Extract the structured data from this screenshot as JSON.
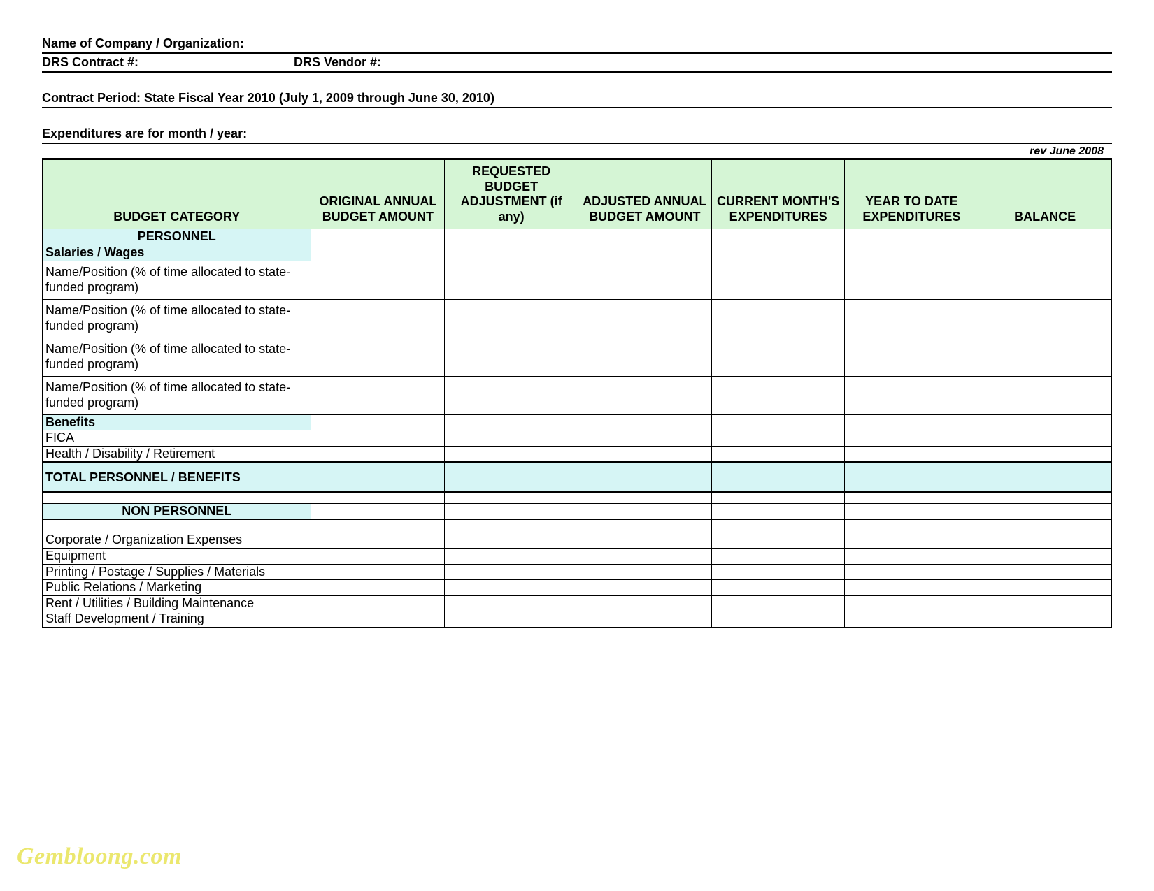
{
  "header": {
    "company_label": "Name of Company / Organization:",
    "contract_label": "DRS Contract #:",
    "vendor_label": "DRS Vendor #:",
    "period_label": "Contract Period: State Fiscal Year 2010 (July 1, 2009 through June 30, 2010)",
    "month_label": "Expenditures are for month / year:",
    "revision": "rev June 2008"
  },
  "columns": [
    "BUDGET CATEGORY",
    "ORIGINAL ANNUAL BUDGET AMOUNT",
    "REQUESTED BUDGET ADJUSTMENT (if any)",
    "ADJUSTED ANNUAL BUDGET AMOUNT",
    "CURRENT MONTH'S EXPENDITURES",
    "YEAR TO DATE EXPENDITURES",
    "BALANCE"
  ],
  "sections": {
    "personnel_title": "PERSONNEL",
    "salaries_title": "Salaries / Wages",
    "name_position": "Name/Position (% of time allocated to state-funded program)",
    "benefits_title": "Benefits",
    "fica": "FICA",
    "health": "Health / Disability / Retirement",
    "total_personnel": "TOTAL PERSONNEL / BENEFITS",
    "nonpersonnel_title": "NON PERSONNEL",
    "corp_expenses": "Corporate / Organization Expenses",
    "equipment": "Equipment",
    "printing": "Printing / Postage / Supplies / Materials",
    "public_relations": "Public Relations / Marketing",
    "rent": "Rent / Utilities / Building Maintenance",
    "staff_dev": "Staff Development / Training"
  },
  "watermark": "Gembloong.com"
}
